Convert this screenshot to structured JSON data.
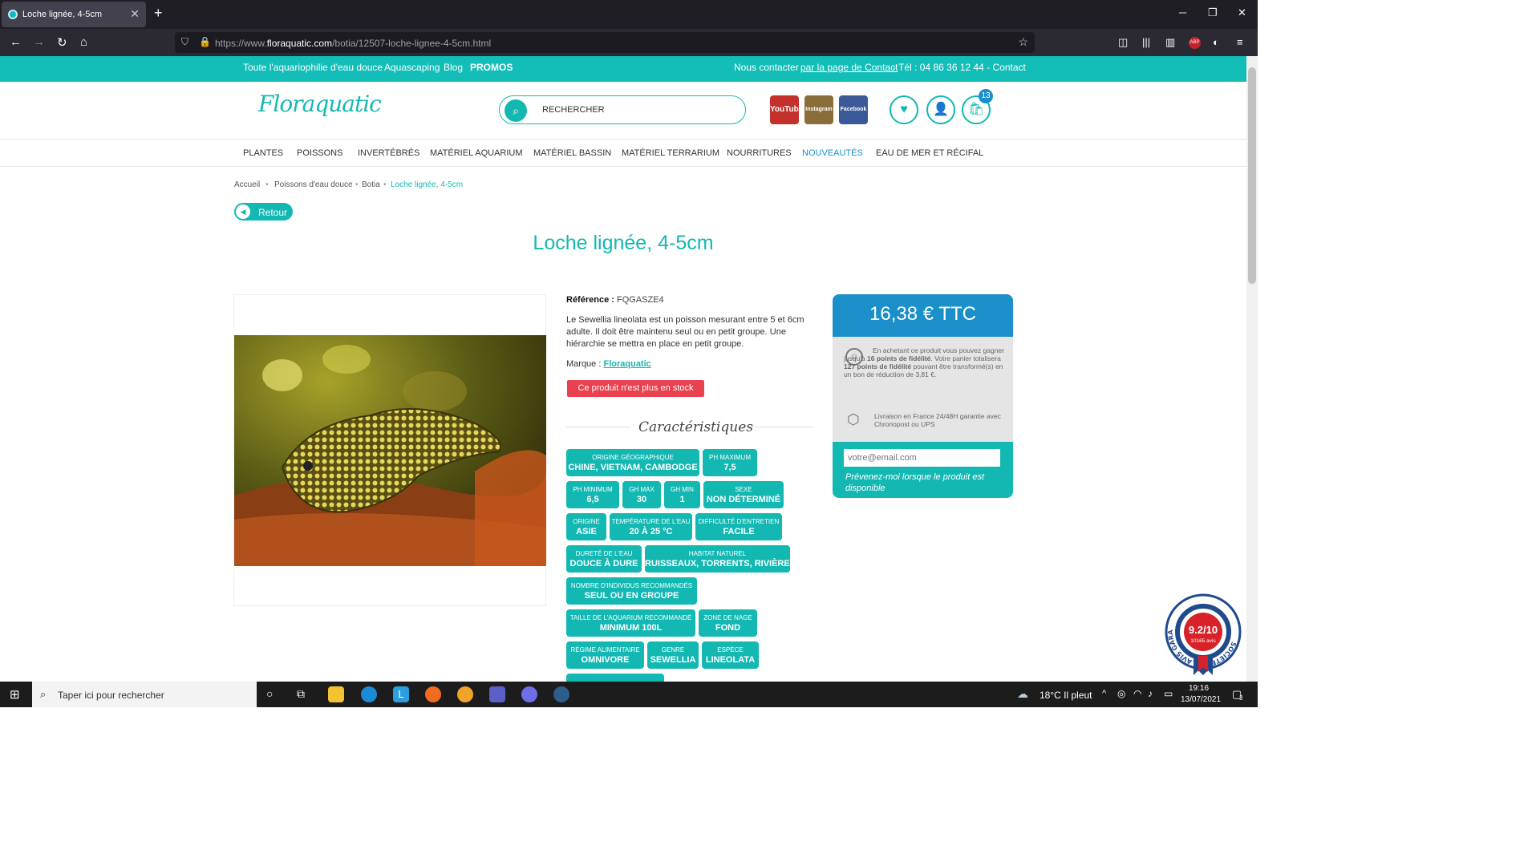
{
  "browser": {
    "tab_title": "Loche lignée, 4-5cm",
    "tab_close": "✕",
    "new_tab": "+",
    "url_prefix": "https://www.",
    "url_domain": "floraquatic.com",
    "url_path": "/botia/12507-loche-lignee-4-5cm.html"
  },
  "topbar": {
    "links": [
      "Toute l'aquariophilie d'eau douce",
      "Aquascaping",
      "Blog",
      "PROMOS"
    ],
    "contact_prefix": "Nous contacter",
    "contact_link": "par la page de Contact",
    "contact_suffix": " - Tél : 04 86 36 12 44 - Contact"
  },
  "header": {
    "logo": "Floraquatic",
    "search_placeholder": "RECHERCHER",
    "cart_count": "13",
    "social": [
      "YouTube",
      "Instagram",
      "Facebook"
    ]
  },
  "menu": [
    "PLANTES",
    "POISSONS",
    "INVERTÉBRÉS",
    "MATÉRIEL AQUARIUM",
    "MATÉRIEL BASSIN",
    "MATÉRIEL TERRARIUM",
    "NOURRITURES",
    "NOUVEAUTÉS",
    "EAU DE MER ET RÉCIFAL"
  ],
  "breadcrumb": [
    "Accueil",
    "Poissons d'eau douce",
    "Botia",
    "Loche lignée, 4-5cm"
  ],
  "back_label": "Retour",
  "product": {
    "title": "Loche lignée, 4-5cm",
    "ref_label": "Référence :",
    "ref_value": "FQGASZE4",
    "description": "Le Sewellia lineolata est un poisson mesurant entre 5 et 6cm adulte. Il doit être maintenu seul ou en petit groupe. Une hiérarchie se mettra en place en petit groupe.",
    "brand_label": "Marque :",
    "brand_value": "Floraquatic",
    "stock": "Ce produit n'est plus en stock",
    "caracteristiques_title": "Caractéristiques",
    "chips": [
      {
        "label": "ORIGINE GÉOGRAPHIQUE",
        "value": "CHINE, VIETNAM, CAMBODGE"
      },
      {
        "label": "PH MAXIMUM",
        "value": "7,5"
      },
      {
        "label": "PH MINIMUM",
        "value": "6,5"
      },
      {
        "label": "GH MAX",
        "value": "30"
      },
      {
        "label": "GH MIN",
        "value": "1"
      },
      {
        "label": "SEXE",
        "value": "NON DÉTERMINÉ"
      },
      {
        "label": "ORIGINE",
        "value": "ASIE"
      },
      {
        "label": "TEMPÉRATURE DE L'EAU",
        "value": "20 À 25 °C"
      },
      {
        "label": "DIFFICULTÉ D'ENTRETIEN",
        "value": "FACILE"
      },
      {
        "label": "DURETÉ DE L'EAU",
        "value": "DOUCE À DURE"
      },
      {
        "label": "HABITAT NATUREL",
        "value": "RUISSEAUX, TORRENTS, RIVIÈRES"
      },
      {
        "label": "NOMBRE D'INDIVIDUS RECOMMANDÉS",
        "value": "SEUL OU EN GROUPE"
      },
      {
        "label": "TAILLE DE L'AQUARIUM RECOMMANDÉ",
        "value": "MINIMUM 100L"
      },
      {
        "label": "ZONE DE NAGE",
        "value": "FOND"
      },
      {
        "label": "RÉGIME ALIMENTAIRE",
        "value": "OMNIVORE"
      },
      {
        "label": "GENRE",
        "value": "SEWELLIA"
      },
      {
        "label": "ESPÈCE",
        "value": "LINEOLATA"
      }
    ]
  },
  "pricebox": {
    "price": "16,38 € TTC",
    "fid_1": "En achetant ce produit vous pouvez gagner jusqu'à ",
    "fid_points": "16 points de fidélité",
    "fid_2": ". Votre panier totalisera ",
    "fid_points2": "127 points de fidélité",
    "fid_3": " pouvant être transformé(s) en un bon de réduction de 3,81 €.",
    "delivery": "Livraison en France 24/48H garantie avec Chronopost ou UPS",
    "email_placeholder": "votre@email.com",
    "notify": "Prévenez-moi lorsque le produit est disponible"
  },
  "avis_badge": {
    "ring_text": "SOCIÉTÉ DES AVIS GARANTIS",
    "score": "9.2",
    "out_of": "/10",
    "count": "10165 avis"
  },
  "taskbar": {
    "search": "Taper ici pour rechercher",
    "weather": "18°C  Il pleut",
    "time": "19:16",
    "date": "13/07/2021",
    "notif_count": "3"
  },
  "colors": {
    "teal": "#14b8b3",
    "blue": "#1a8fc9",
    "red": "#e8414f"
  }
}
